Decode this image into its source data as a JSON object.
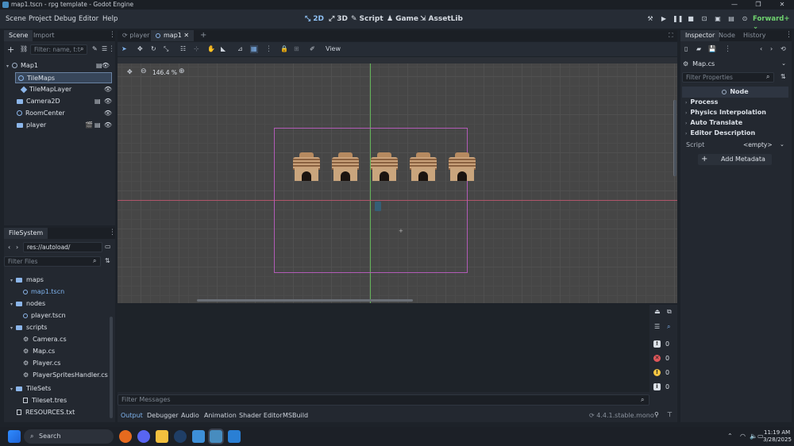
{
  "window": {
    "title": "map1.tscn - rpg template - Godot Engine"
  },
  "menu": {
    "items": [
      "Scene",
      "Project",
      "Debug",
      "Editor",
      "Help"
    ]
  },
  "workspaces": {
    "w2d": "2D",
    "w3d": "3D",
    "script": "Script",
    "game": "Game",
    "assetlib": "AssetLib"
  },
  "renderer": "Forward+",
  "scene_dock": {
    "tabs": [
      "Scene",
      "Import"
    ],
    "filter_placeholder": "Filter: name, t:t",
    "nodes": {
      "map1": "Map1",
      "tilemaps": "TileMaps",
      "tilemaplayer": "TileMapLayer",
      "camera2d": "Camera2D",
      "roomcenter": "RoomCenter",
      "player": "player"
    }
  },
  "filesystem": {
    "tab": "FileSystem",
    "path": "res://autoload/",
    "filter_placeholder": "Filter Files",
    "items": {
      "maps": "maps",
      "map1": "map1.tscn",
      "nodes": "nodes",
      "player_tscn": "player.tscn",
      "scripts": "scripts",
      "camera_cs": "Camera.cs",
      "map_cs": "Map.cs",
      "player_cs": "Player.cs",
      "player_sprites": "PlayerSpritesHandler.cs",
      "tilesets": "TileSets",
      "tileset_tres": "Tileset.tres",
      "resources_txt": "RESOURCES.txt"
    }
  },
  "editor_tabs": [
    "player",
    "map1"
  ],
  "toolbar": {
    "view": "View"
  },
  "viewport": {
    "zoom": "146.4 %"
  },
  "bottom": {
    "filter_placeholder": "Filter Messages",
    "tabs": [
      "Output",
      "Debugger",
      "Audio",
      "Animation",
      "Shader Editor",
      "MSBuild"
    ],
    "version": "4.4.1.stable.mono",
    "counts": {
      "errors_all": "0",
      "errors": "0",
      "warnings": "0",
      "info": "0"
    }
  },
  "inspector": {
    "tabs": [
      "Inspector",
      "Node",
      "History"
    ],
    "object": "Map.cs",
    "filter_placeholder": "Filter Properties",
    "class_header": "Node",
    "sections": [
      "Process",
      "Physics Interpolation",
      "Auto Translate",
      "Editor Description"
    ],
    "script_label": "Script",
    "script_value": "<empty>",
    "add_metadata": "Add Metadata"
  },
  "taskbar": {
    "search_placeholder": "Search",
    "time": "11:19 AM",
    "date": "3/28/2025"
  },
  "colors": {
    "accent": "#8fc1f5",
    "renderer": "#6fd36f",
    "selection": "#37465a"
  }
}
